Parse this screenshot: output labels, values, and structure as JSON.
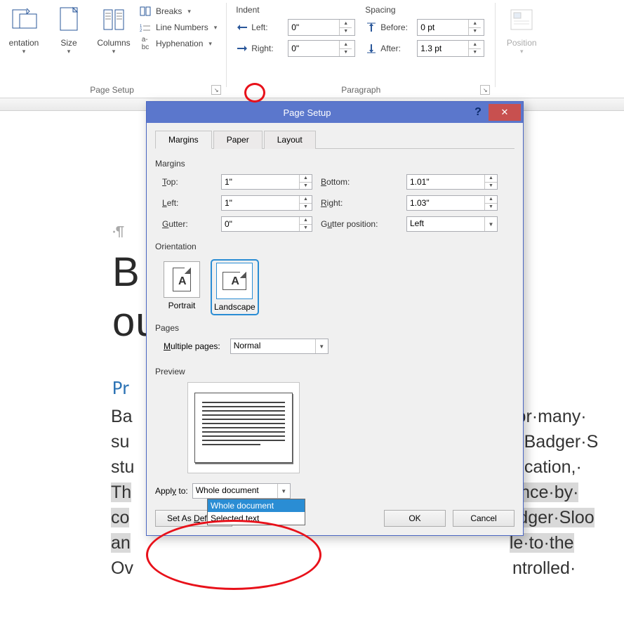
{
  "ribbon": {
    "pagesetup": {
      "label": "Page Setup",
      "orientation": "entation",
      "size": "Size",
      "columns": "Columns",
      "breaks": "Breaks",
      "linenumbers": "Line Numbers",
      "hyphenation": "Hyphenation"
    },
    "paragraph": {
      "label": "Paragraph",
      "indent_hdr": "Indent",
      "spacing_hdr": "Spacing",
      "left_lbl": "Left:",
      "right_lbl": "Right:",
      "before_lbl": "Before:",
      "after_lbl": "After:",
      "left_val": "0\"",
      "right_val": "0\"",
      "before_val": "0 pt",
      "after_val": "1.3 pt"
    },
    "position": {
      "label": "Position"
    }
  },
  "dialog": {
    "title": "Page Setup",
    "tabs": {
      "margins": "Margins",
      "paper": "Paper",
      "layout": "Layout"
    },
    "margins": {
      "section": "Margins",
      "top_lbl": "Top:",
      "top_val": "1\"",
      "bottom_lbl": "Bottom:",
      "bottom_val": "1.01\"",
      "left_lbl": "Left:",
      "left_val": "1\"",
      "right_lbl": "Right:",
      "right_val": "1.03\"",
      "gutter_lbl": "Gutter:",
      "gutter_val": "0\"",
      "gutterpos_lbl": "Gutter position:",
      "gutterpos_val": "Left"
    },
    "orientation": {
      "section": "Orientation",
      "portrait": "Portrait",
      "landscape": "Landscape"
    },
    "pages": {
      "section": "Pages",
      "multi_lbl": "Multiple pages:",
      "multi_val": "Normal"
    },
    "preview": {
      "section": "Preview"
    },
    "apply": {
      "label": "Apply to:",
      "value": "Whole document",
      "options": [
        "Whole document",
        "Selected text"
      ]
    },
    "buttons": {
      "default": "Set As Default",
      "ok": "OK",
      "cancel": "Cancel"
    }
  },
  "doc": {
    "title_fragment_left": "B",
    "title_fragment_right": "ous¶",
    "h2": "Pr",
    "body_lines": [
      "Ba",
      "su",
      "stu",
      "Th",
      "co",
      "an",
      "Ov"
    ],
    "body_right": [
      "for·many·",
      "n·Badger·S",
      "nication,·",
      "ence·by·",
      "adger·Sloo",
      "le·to·the",
      "ntrolled·"
    ]
  }
}
